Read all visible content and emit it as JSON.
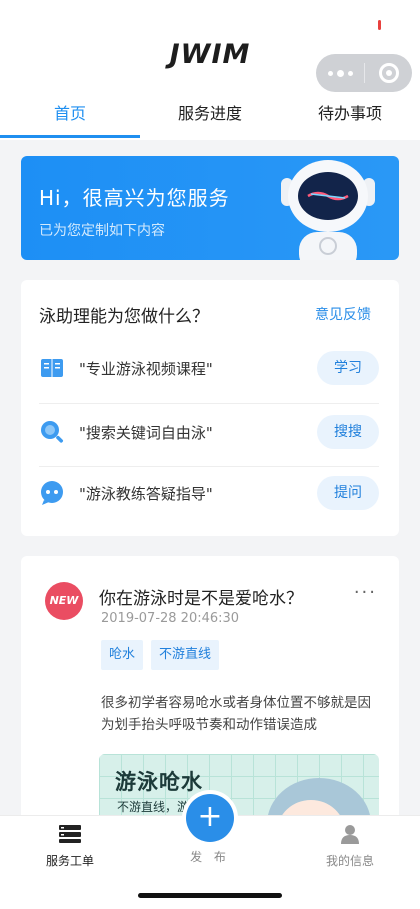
{
  "header": {
    "logo": "JWIM"
  },
  "tabs": [
    {
      "label": "首页",
      "active": true
    },
    {
      "label": "服务进度",
      "active": false
    },
    {
      "label": "待办事项",
      "active": false
    }
  ],
  "banner": {
    "greeting": "Hi，很高兴为您服务",
    "subtitle": "已为您定制如下内容"
  },
  "assistant": {
    "title": "泳助理能为您做什么？",
    "feedback": "意见反馈",
    "items": [
      {
        "text": "\"专业游泳视频课程\"",
        "button": "学习",
        "icon": "book-icon"
      },
      {
        "text": "\"搜索关键词自由泳\"",
        "button": "搜搜",
        "icon": "search-icon"
      },
      {
        "text": "\"游泳教练答疑指导\"",
        "button": "提问",
        "icon": "chat-icon"
      }
    ]
  },
  "article": {
    "badge": "NEW",
    "title": "你在游泳时是不是爱呛水？",
    "more": "···",
    "date": "2019-07-28 20:46:30",
    "tags": [
      "呛水",
      "不游直线"
    ],
    "body": "很多初学者容易呛水或者身体位置不够就是因为划手抬头呼吸节奏和动作错误造成",
    "thumb_title": "游泳呛水",
    "thumb_sub": "不游直线，游"
  },
  "bottom_nav": {
    "service": "服务工单",
    "publish": "发 布",
    "profile": "我的信息"
  },
  "colors": {
    "accent": "#1f8ff0",
    "badge": "#ea4d62"
  }
}
